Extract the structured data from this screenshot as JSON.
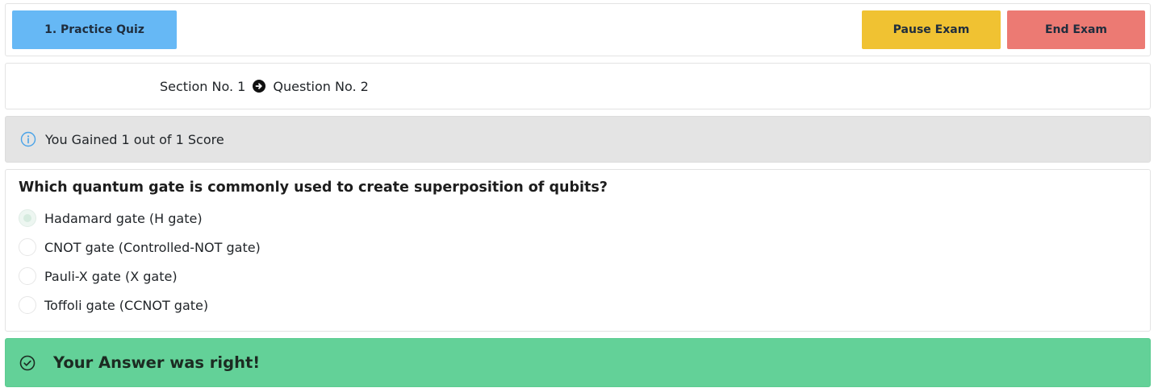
{
  "toolbar": {
    "quiz_label": "1. Practice Quiz",
    "pause_label": "Pause Exam",
    "end_label": "End Exam"
  },
  "breadcrumb": {
    "section": "Section No. 1",
    "question": "Question No. 2",
    "separator_icon": "arrow-right-circle-icon"
  },
  "score": {
    "icon": "info-icon",
    "text": "You Gained 1 out of 1 Score"
  },
  "question": {
    "title": "Which quantum gate is commonly used to create superposition of qubits?",
    "options": [
      {
        "label": "Hadamard gate (H gate)",
        "selected": true
      },
      {
        "label": "CNOT gate (Controlled-NOT gate)",
        "selected": false
      },
      {
        "label": "Pauli-X gate (X gate)",
        "selected": false
      },
      {
        "label": "Toffoli gate (CCNOT gate)",
        "selected": false
      }
    ]
  },
  "result": {
    "icon": "check-circle-icon",
    "text": "Your Answer was right!"
  },
  "colors": {
    "quiz_button": "#66b8f5",
    "pause_button": "#f0c232",
    "end_button": "#ec7a73",
    "score_bg": "#e4e4e4",
    "result_bg": "#63d198"
  }
}
